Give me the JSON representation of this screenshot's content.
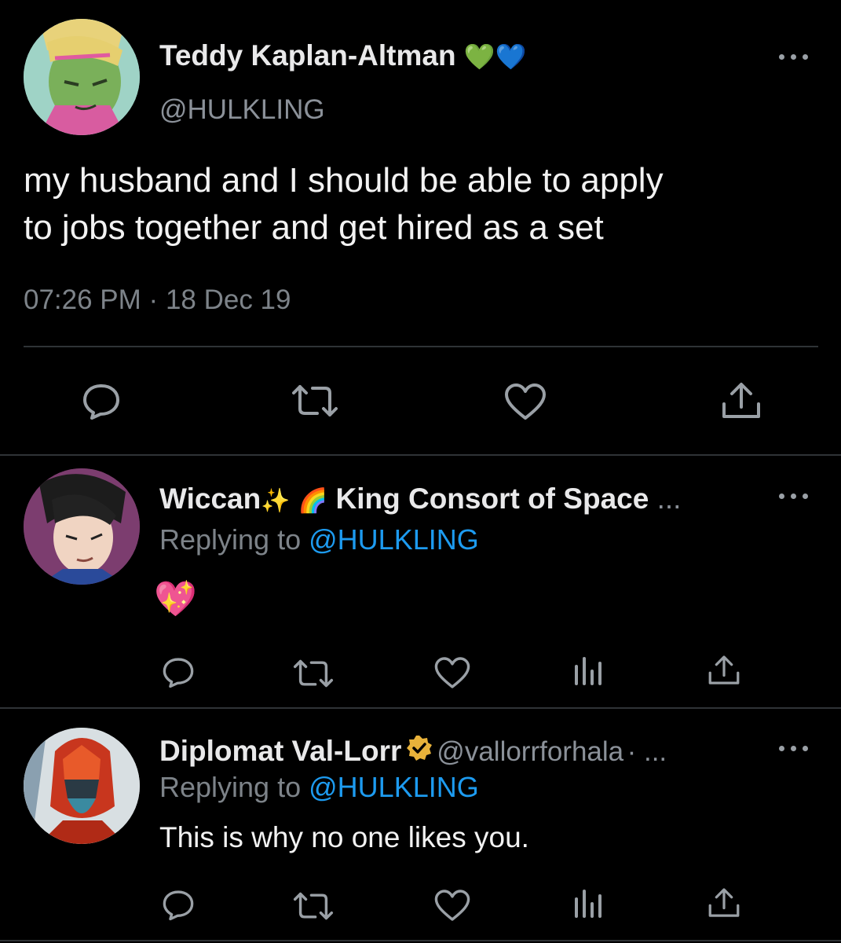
{
  "main_tweet": {
    "display_name": "Teddy Kaplan-Altman",
    "name_emoji": "💚💙",
    "handle": "@HULKLING",
    "text_line1": "my husband and I should be able to apply",
    "text_line2": "to jobs together and get hired as a set",
    "time": "07:26 PM",
    "separator": "·",
    "date": "18 Dec 19"
  },
  "replies": [
    {
      "display_name": "Wiccan",
      "sparkle": "✨",
      "rainbow": "🌈",
      "display_name_2": "King Consort of Space",
      "ellipsis": "...",
      "replying_prefix": "Replying to",
      "replying_handle": "@HULKLING",
      "text": "💖"
    },
    {
      "display_name": "Diplomat Val-Lorr",
      "handle": "@vallorrforhala",
      "handle_suffix": "· ...",
      "replying_prefix": "Replying to",
      "replying_handle": "@HULKLING",
      "text": "This is why no one likes you."
    }
  ],
  "icons": {
    "reply": "reply-icon",
    "retweet": "retweet-icon",
    "like": "heart-icon",
    "share": "share-icon",
    "analytics": "analytics-icon",
    "more": "more-options-icon",
    "verified": "verified-badge-icon"
  },
  "colors": {
    "background": "#000000",
    "link": "#1d9bf0",
    "muted": "#7d8389",
    "icon": "#9aa0a6",
    "verified": "#e8b23a"
  }
}
